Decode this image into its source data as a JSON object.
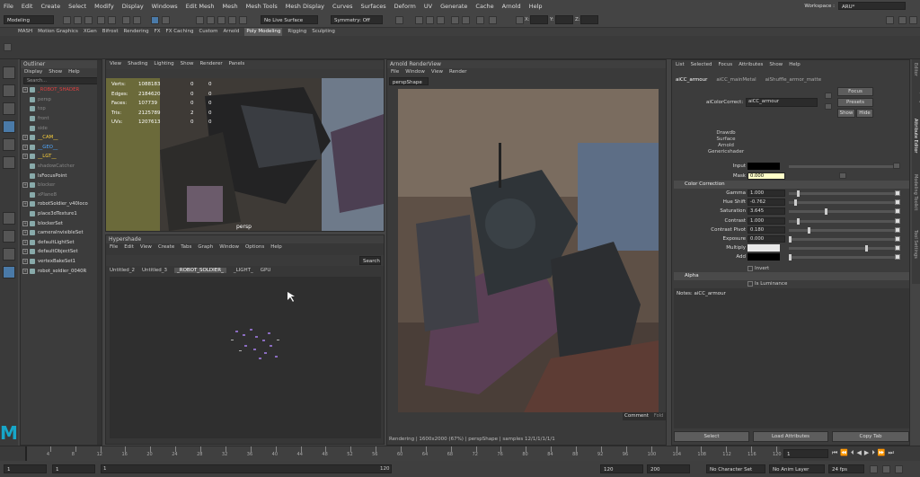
{
  "menubar": {
    "items": [
      "File",
      "Edit",
      "Create",
      "Select",
      "Modify",
      "Display",
      "Windows",
      "Edit Mesh",
      "Mesh",
      "Mesh Tools",
      "Mesh Display",
      "Curves",
      "Surfaces",
      "Deform",
      "UV",
      "Generate",
      "Cache",
      "Arnold",
      "Help"
    ],
    "workspace_label": "Workspace :",
    "workspace_value": "ARU*"
  },
  "statusline": {
    "mode": "Modeling",
    "live_surface": "No Live Surface",
    "symmetry": "Symmetry: Off"
  },
  "shelf_tabs": [
    "MASH",
    "Motion Graphics",
    "XGen",
    "Bifrost",
    "Rendering",
    "FX",
    "FX Caching",
    "Custom",
    "Arnold",
    "Poly Modeling",
    "Rigging",
    "Sculpting"
  ],
  "shelf_active": "Poly Modeling",
  "outliner": {
    "title": "Outliner",
    "menu": [
      "Display",
      "Show",
      "Help"
    ],
    "search": "Search...",
    "items": [
      {
        "label": "_ROBOT_SHADER",
        "style": "red",
        "plus": true
      },
      {
        "label": "persp",
        "style": "grey"
      },
      {
        "label": "top",
        "style": "grey"
      },
      {
        "label": "front",
        "style": "grey"
      },
      {
        "label": "side",
        "style": "grey"
      },
      {
        "label": "__CAM__",
        "style": "yel",
        "plus": true
      },
      {
        "label": "__GEO__",
        "style": "blue",
        "plus": true
      },
      {
        "label": "__LGT__",
        "style": "yel",
        "plus": true
      },
      {
        "label": "shadowCatcher",
        "style": "grey"
      },
      {
        "label": "lsFocusPoint",
        "style": ""
      },
      {
        "label": "blocker",
        "style": "grey",
        "plus": true
      },
      {
        "label": "xPlane8",
        "style": "grey"
      },
      {
        "label": "robotSoldier_v40loco",
        "style": "",
        "plus": true
      },
      {
        "label": "place3dTexture1",
        "style": ""
      },
      {
        "label": "blockerSet",
        "style": "",
        "plus": true
      },
      {
        "label": "cameraInvisibleSet",
        "style": "",
        "plus": true
      },
      {
        "label": "defaultLightSet",
        "style": "",
        "plus": true
      },
      {
        "label": "defaultObjectSet",
        "style": "",
        "plus": true
      },
      {
        "label": "vertexBakeSet1",
        "style": "",
        "plus": true
      },
      {
        "label": "robot_soldier_0040R",
        "style": "",
        "plus": true
      }
    ]
  },
  "viewport": {
    "menu": [
      "View",
      "Shading",
      "Lighting",
      "Show",
      "Renderer",
      "Panels"
    ],
    "camera": "persp",
    "hud": [
      {
        "k": "Verts:",
        "v": "1088183",
        "a": "0",
        "b": "0"
      },
      {
        "k": "Edges:",
        "v": "2184620",
        "a": "0",
        "b": "0"
      },
      {
        "k": "Faces:",
        "v": "107739",
        "a": "0",
        "b": "0"
      },
      {
        "k": "Tris:",
        "v": "2125789",
        "a": "2",
        "b": "0"
      },
      {
        "k": "UVs:",
        "v": "1207613",
        "a": "0",
        "b": "0"
      }
    ]
  },
  "hypershade": {
    "title": "Hypershade",
    "menu": [
      "File",
      "Edit",
      "View",
      "Create",
      "Tabs",
      "Graph",
      "Window",
      "Options",
      "Help"
    ],
    "search": "Search",
    "tabs": [
      "Untitled_2",
      "Untitled_3",
      "_ROBOT_SOLDIER_",
      "_LIGHT_",
      "GPU"
    ]
  },
  "renderview": {
    "title": "Arnold RenderView",
    "menu": [
      "File",
      "Window",
      "View",
      "Render"
    ],
    "camera": "perspShape",
    "status": "Rendering | 1600x2000 (67%) | perspShape | samples 12/1/1/1/1/1",
    "comment": "Comment",
    "fold": "Fold"
  },
  "attr": {
    "menu": [
      "List",
      "Selected",
      "Focus",
      "Attributes",
      "Show",
      "Help"
    ],
    "tabs": [
      "aiCC_armour",
      "aiCC_mainMetal",
      "aiShuffle_armor_matte"
    ],
    "node_label": "aiColorCorrect:",
    "node_name": "aiCC_armour",
    "focus": "Focus",
    "presets": "Presets",
    "show": "Show",
    "hide": "Hide",
    "classes": [
      "Drawdb",
      "Surface",
      "Arnold",
      "Genericshader"
    ],
    "input_label": "Input",
    "mask_label": "Mask",
    "mask_value": "0.000",
    "cc_title": "Color Correction",
    "rows": [
      {
        "k": "Gamma",
        "v": "1.000",
        "p": 0.08
      },
      {
        "k": "Hue Shift",
        "v": "-0.762",
        "p": 0.05
      },
      {
        "k": "Saturation",
        "v": "3.645",
        "p": 0.35
      },
      {
        "k": "Contrast",
        "v": "1.000",
        "p": 0.08
      },
      {
        "k": "Contrast Pivot",
        "v": "0.180",
        "p": 0.18
      },
      {
        "k": "Exposure",
        "v": "0.000",
        "p": 0.0
      },
      {
        "k": "Multiply",
        "v": "",
        "p": 0.74
      },
      {
        "k": "Add",
        "v": "",
        "p": 0.0
      }
    ],
    "invert": "Invert",
    "alpha_title": "Alpha",
    "is_lum": "Is Luminance",
    "notes": "Notes:  aiCC_armour",
    "select": "Select",
    "load": "Load Attributes",
    "copy": "Copy Tab"
  },
  "side_tabs": [
    "Channel Box / Layer Editor",
    "Attribute Editor",
    "Modeling Toolkit",
    "Tool Settings"
  ],
  "timeline": {
    "ticks": [
      "4",
      "8",
      "12",
      "16",
      "20",
      "24",
      "28",
      "32",
      "36",
      "40",
      "44",
      "48",
      "52",
      "56",
      "60",
      "64",
      "68",
      "72",
      "76",
      "80",
      "84",
      "88",
      "92",
      "96",
      "100",
      "104",
      "108",
      "112",
      "116",
      "120"
    ],
    "current": "1"
  },
  "range": {
    "start": "1",
    "start2": "1",
    "cur": "1",
    "end_inner": "120",
    "end": "120",
    "end2": "200",
    "charset": "No Character Set",
    "animlayer": "No Anim Layer",
    "fps": "24 fps"
  },
  "logo": "M"
}
